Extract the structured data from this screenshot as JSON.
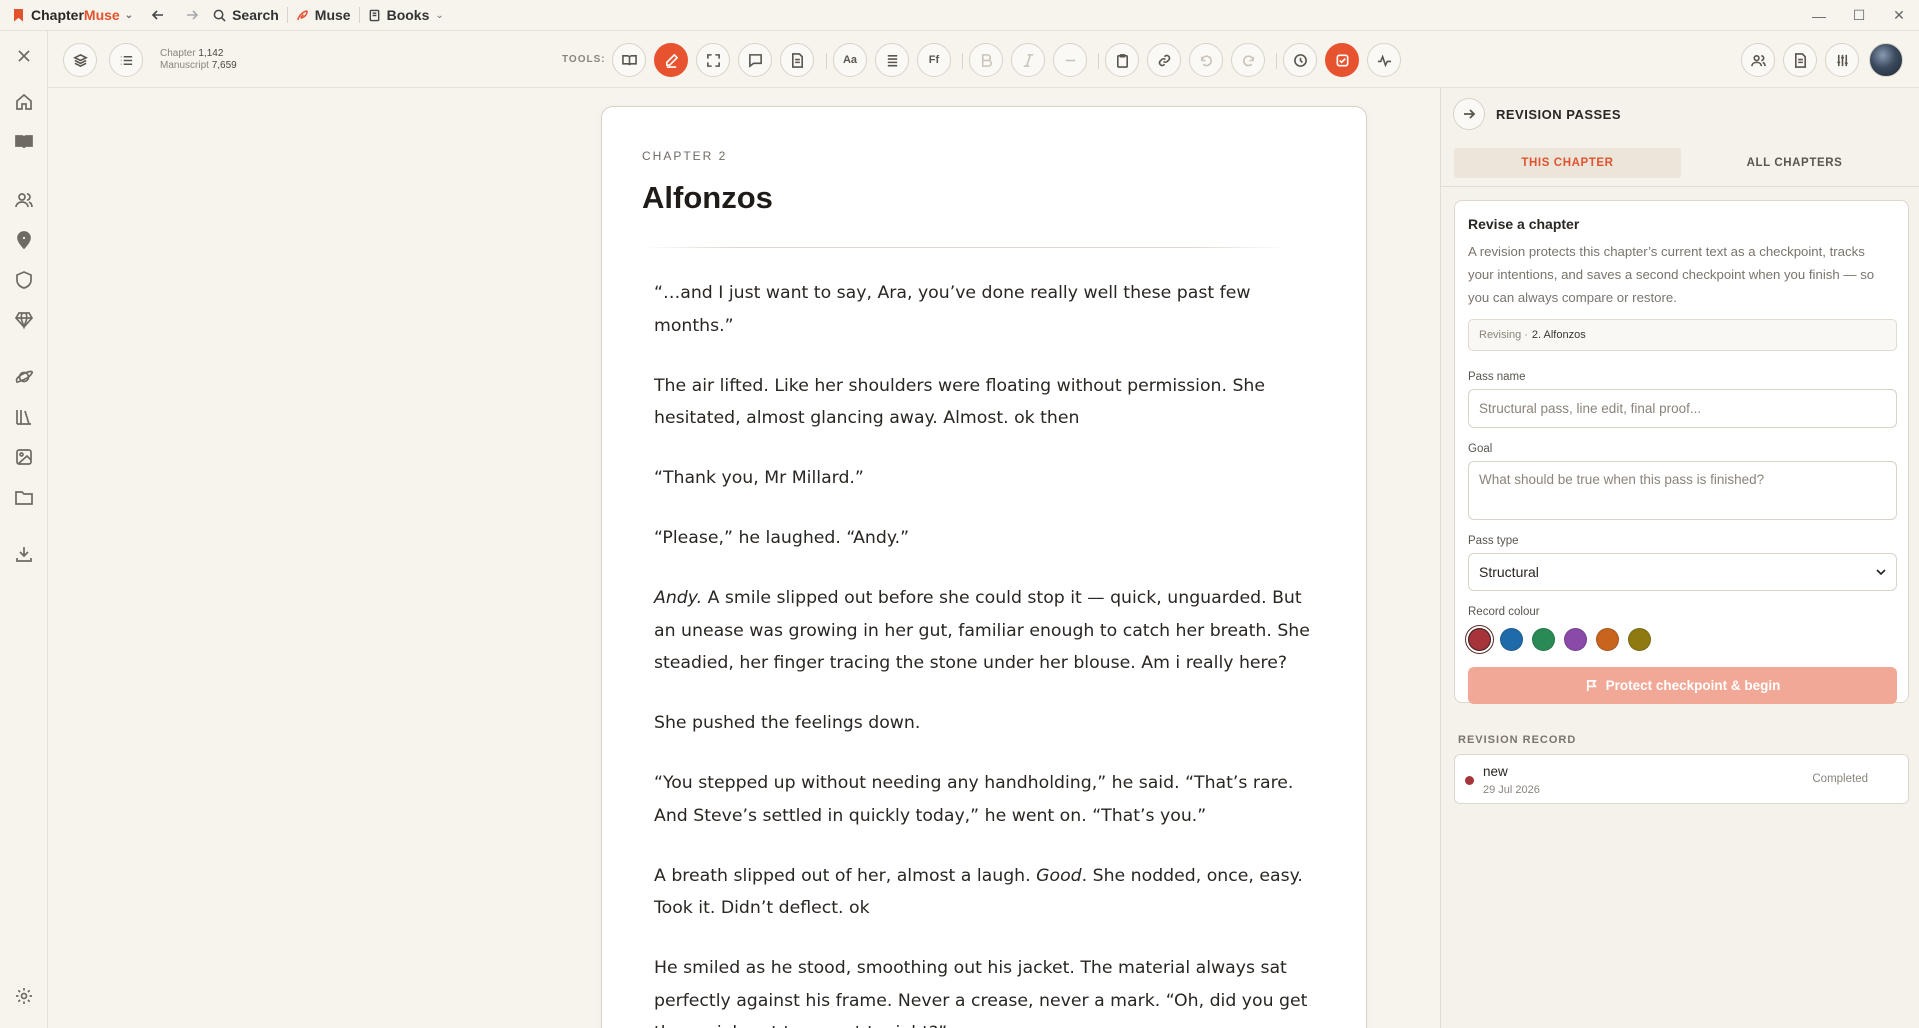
{
  "app": {
    "brand_part1": "Chapter",
    "brand_part2": "Muse",
    "nav_search": "Search",
    "nav_muse": "Muse",
    "nav_books": "Books"
  },
  "toolbar": {
    "chapter_label": "Chapter",
    "chapter_count": "1,142",
    "manuscript_label": "Manuscript",
    "manuscript_count": "7,659",
    "tools_label": "TOOLS:",
    "font_btn": "Aa",
    "ff_btn": "Ff",
    "accent_color": "#e8532f"
  },
  "document": {
    "chapter_label": "CHAPTER 2",
    "title": "Alfonzos",
    "p1": "“…and I just want to say, Ara, you’ve done really well these past few months.”",
    "p2": "The air lifted. Like her shoulders were floating without permission. She hesitated, almost glancing away. Almost. ok then",
    "p3": "“Thank you, Mr Millard.”",
    "p4": "“Please,” he laughed. “Andy.”",
    "p5_em": "Andy.",
    "p5_rest": " A smile slipped out before she could stop it — quick, unguarded. But an unease was growing in her gut, familiar enough to catch her breath. She steadied, her finger tracing the stone under her blouse. Am i really here?",
    "p6": "She pushed the feelings down.",
    "p7": "“You stepped up without needing any handholding,” he said. “That’s rare. And Steve’s settled in quickly today,” he went on. “That’s you.”",
    "p8_a": "A breath slipped out of her, almost a laugh. ",
    "p8_em": "Good",
    "p8_b": ". She nodded, once, easy. Took it. Didn’t deflect. ok",
    "p9": "He smiled as he stood, smoothing out his jacket. The material always sat perfectly against his frame. Never a crease, never a mark. “Oh, did you get the socials set to go out tonight?”"
  },
  "panel": {
    "title": "REVISION PASSES",
    "tab_this": "THIS CHAPTER",
    "tab_all": "ALL CHAPTERS",
    "card_title": "Revise a chapter",
    "card_desc": "A revision protects this chapter’s current text as a checkpoint, tracks your intentions, and saves a second checkpoint when you finish — so you can always compare or restore.",
    "revising_label": "Revising ·",
    "revising_value": "2. Alfonzos",
    "pass_name_label": "Pass name",
    "pass_name_placeholder": "Structural pass, line edit, final proof...",
    "goal_label": "Goal",
    "goal_placeholder": "What should be true when this pass is finished?",
    "pass_type_label": "Pass type",
    "pass_type_value": "Structural",
    "record_colour_label": "Record colour",
    "swatches": [
      "#a8343b",
      "#1f6aa8",
      "#2a8a55",
      "#8a4aa8",
      "#c8641e",
      "#8f7a12"
    ],
    "protect_button": "Protect checkpoint & begin",
    "record_label": "REVISION RECORD",
    "record_item": {
      "name": "new",
      "date": "29 Jul 2026",
      "status": "Completed",
      "color": "#a8343b"
    }
  }
}
